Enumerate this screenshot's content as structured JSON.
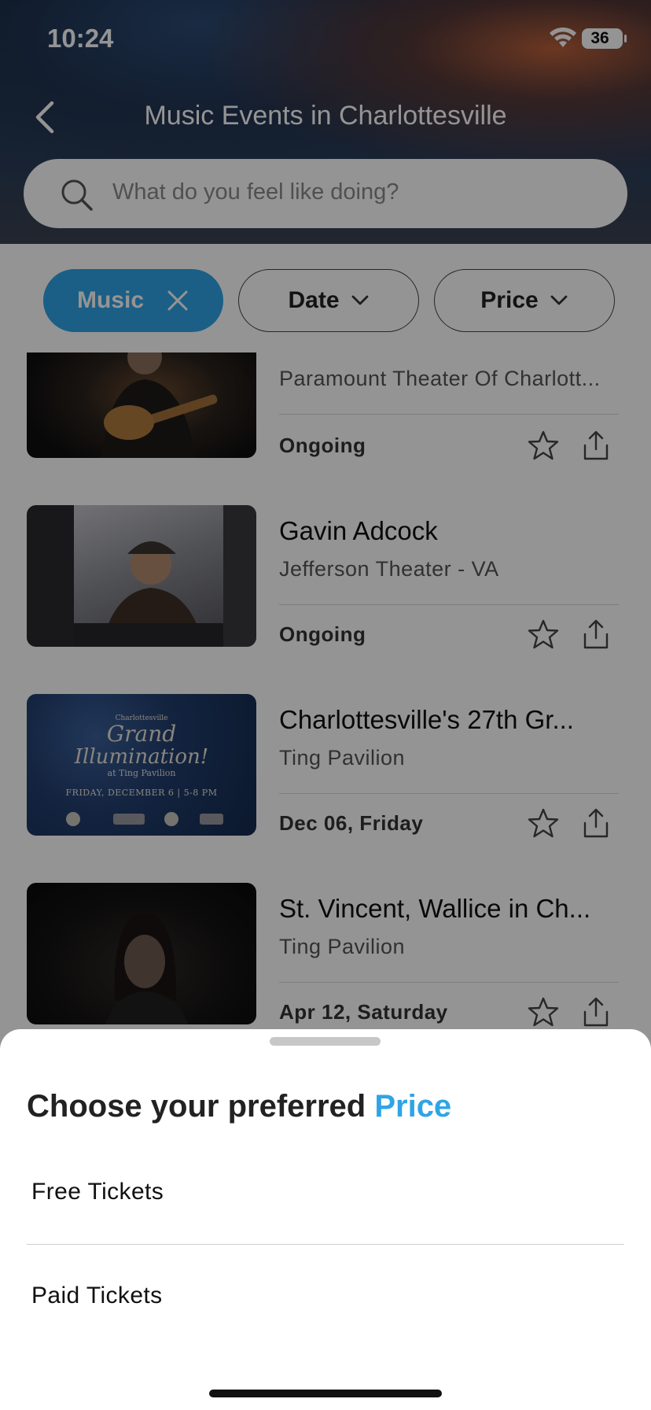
{
  "status": {
    "time": "10:24",
    "battery": "36"
  },
  "header": {
    "title": "Music Events in Charlottesville",
    "search_placeholder": "What do you feel like doing?"
  },
  "filters": {
    "music": "Music",
    "date": "Date",
    "price": "Price"
  },
  "events": [
    {
      "title": "",
      "venue": "Paramount Theater Of Charlott...",
      "date": "Ongoing"
    },
    {
      "title": "Gavin Adcock",
      "venue": "Jefferson Theater - VA",
      "date": "Ongoing"
    },
    {
      "title": "Charlottesville's 27th Gr...",
      "venue": "Ting Pavilion",
      "date": "Dec 06, Friday",
      "poster": {
        "line1": "Charlottesville",
        "line2": "Grand",
        "line3": "Illumination!",
        "line4": "at Ting Pavilion",
        "line5": "FRIDAY, DECEMBER 6  |  5-8 PM"
      }
    },
    {
      "title": "St. Vincent, Wallice in Ch...",
      "venue": "Ting Pavilion",
      "date": "Apr 12, Saturday"
    }
  ],
  "sheet": {
    "title_prefix": "Choose your preferred ",
    "title_accent": "Price",
    "options": [
      "Free Tickets",
      "Paid Tickets"
    ]
  },
  "colors": {
    "accent": "#2fa4e7"
  }
}
